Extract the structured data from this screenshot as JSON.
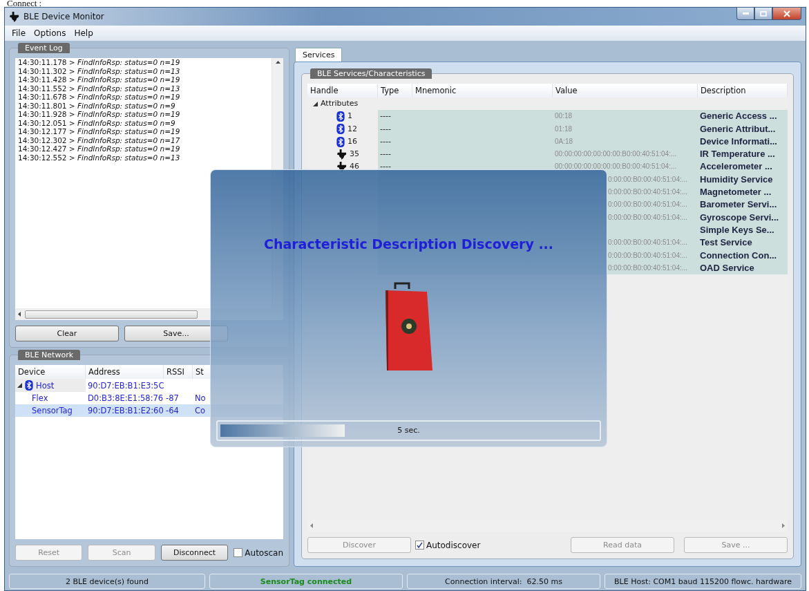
{
  "caption": "Connect :",
  "window": {
    "title": "BLE Device Monitor"
  },
  "menu": [
    "File",
    "Options",
    "Help"
  ],
  "event_log": {
    "title": "Event Log",
    "entries": [
      "14:30:11.178 > *FindInfoRsp: status=0 n=19*",
      "14:30:11.302 > *FindInfoRsp: status=0 n=13*",
      "14:30:11.428 > *FindInfoRsp: status=0 n=19*",
      "14:30:11.552 > *FindInfoRsp: status=0 n=13*",
      "14:30:11.678 > *FindInfoRsp: status=0 n=19*",
      "14:30:11.801 > *FindInfoRsp: status=0 n=9*",
      "14:30:11.928 > *FindInfoRsp: status=0 n=19*",
      "14:30:12.051 > *FindInfoRsp: status=0 n=9*",
      "14:30:12.177 > *FindInfoRsp: status=0 n=19*",
      "14:30:12.302 > *FindInfoRsp: status=0 n=17*",
      "14:30:12.427 > *FindInfoRsp: status=0 n=19*",
      "14:30:12.552 > *FindInfoRsp: status=0 n=13*"
    ],
    "buttons": [
      "Clear",
      "Save..."
    ]
  },
  "network": {
    "title": "BLE Network",
    "columns": [
      "Device",
      "Address",
      "RSSI",
      "St"
    ],
    "host": {
      "name": "Host",
      "address": "90:D7:EB:B1:E3:5C",
      "expanded": true,
      "children": [
        {
          "name": "Flex",
          "address": "D0:B3:8E:E1:58:76",
          "rssi": "-87",
          "status": "No",
          "selected": false
        },
        {
          "name": "SensorTag",
          "address": "90:D7:EB:B1:E2:60",
          "rssi": "-64",
          "status": "Co",
          "selected": true
        }
      ]
    },
    "buttons": [
      {
        "label": "Reset",
        "disabled": true
      },
      {
        "label": "Scan",
        "disabled": true
      },
      {
        "label": "Disconnect",
        "disabled": false
      }
    ],
    "autoscan": {
      "label": "Autoscan",
      "checked": false
    }
  },
  "services": {
    "tabs": [
      {
        "label": "Services",
        "selected": true
      }
    ],
    "title": "BLE Services/Characteristics",
    "columns": [
      "Handle",
      "Type",
      "Mnemonic",
      "Value",
      "Description"
    ],
    "root": {
      "label": "Attributes",
      "expanded": true
    },
    "rows": [
      {
        "kind": "bluetooth",
        "handle": "1",
        "type": "----",
        "value": "00:18",
        "description": "Generic Access ..."
      },
      {
        "kind": "bluetooth",
        "handle": "12",
        "type": "----",
        "value": "01:18",
        "description": "Generic Attribut..."
      },
      {
        "kind": "bluetooth",
        "handle": "16",
        "type": "----",
        "value": "0A:18",
        "description": "Device Informati..."
      },
      {
        "kind": "ti",
        "handle": "35",
        "type": "----",
        "value": "00:00:00:00:00:00:00:B0:00:40:51:04:...",
        "description": "IR Temperature ..."
      },
      {
        "kind": "ti",
        "handle": "46",
        "type": "----",
        "value": "00:00:00:00:00:00:00:B0:00:40:51:04:...",
        "description": "Accelerometer ..."
      },
      {
        "value": "0:00:00:B0:00:40:51:04:...",
        "description": "Humidity Service"
      },
      {
        "value": "0:00:00:B0:00:40:51:04:...",
        "description": "Magnetometer ..."
      },
      {
        "value": "0:00:00:B0:00:40:51:04:...",
        "description": "Barometer Servi..."
      },
      {
        "value": "0:00:00:B0:00:40:51:04:...",
        "description": "Gyroscope Servi..."
      },
      {
        "description": "Simple Keys Se..."
      },
      {
        "value": "0:00:00:B0:00:40:51:04:...",
        "description": "Test Service"
      },
      {
        "value": "0:00:00:B0:00:40:51:04:...",
        "description": "Connection Con..."
      },
      {
        "value": "0:00:00:B0:00:40:51:04:...",
        "description": "OAD Service"
      }
    ],
    "buttons": [
      {
        "label": "Discover",
        "disabled": true
      },
      {
        "label": "Read data",
        "disabled": true
      },
      {
        "label": "Save ...",
        "disabled": true
      }
    ],
    "autodiscover": {
      "label": "Autodiscover",
      "checked": true
    }
  },
  "overlay": {
    "message": "Characteristic Description Discovery ...",
    "progress": {
      "level": 0.33,
      "label": "5 sec."
    }
  },
  "status_bar": [
    {
      "kind": "plain",
      "text": "2 BLE device(s) found"
    },
    {
      "kind": "success",
      "text": "SensorTag connected"
    },
    {
      "kind": "plain",
      "text": "Connection interval:  62.50 ms"
    },
    {
      "kind": "plain",
      "text": "BLE Host: COM1 baud 115200 flowc. hardware"
    }
  ]
}
